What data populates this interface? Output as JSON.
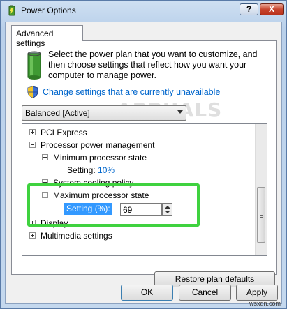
{
  "window": {
    "title": "Power Options",
    "help_label": "?",
    "close_label": "X"
  },
  "tab": {
    "label": "Advanced settings"
  },
  "description": "Select the power plan that you want to customize, and then choose settings that reflect how you want your computer to manage power.",
  "change_link": "Change settings that are currently unavailable",
  "watermark": "APPUALS",
  "plan_select": {
    "value": "Balanced [Active]"
  },
  "tree": {
    "pci_express": "PCI Express",
    "processor_power": "Processor power management",
    "min_state": "Minimum processor state",
    "min_setting_label": "Setting:",
    "min_setting_value": "10%",
    "cooling_policy": "System cooling policy",
    "max_state": "Maximum processor state",
    "max_setting_label": "Setting (%):",
    "max_setting_value": "69",
    "display": "Display",
    "multimedia": "Multimedia settings"
  },
  "buttons": {
    "restore": "Restore plan defaults",
    "ok": "OK",
    "cancel": "Cancel",
    "apply": "Apply"
  },
  "footer": "wsxdn.com",
  "colors": {
    "highlight": "#3fd23f",
    "link": "#0066cc",
    "selection": "#3399ff"
  }
}
